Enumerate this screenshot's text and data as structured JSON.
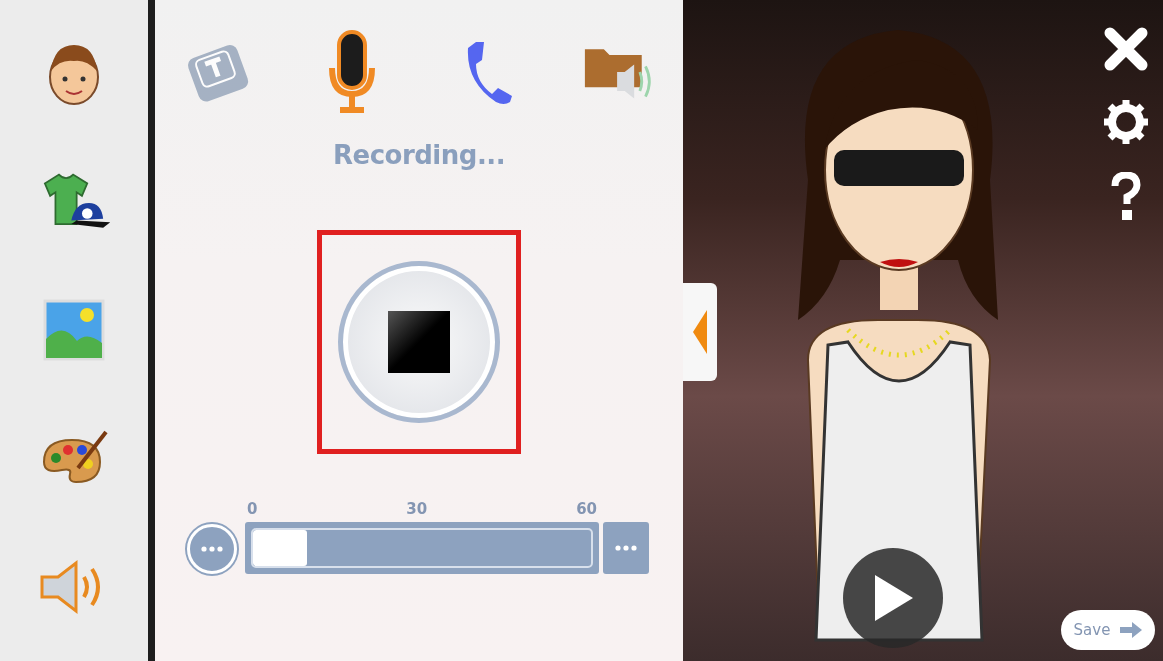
{
  "sidebar": {
    "items": [
      {
        "kind": "face"
      },
      {
        "kind": "outfit"
      },
      {
        "kind": "background"
      },
      {
        "kind": "palette"
      },
      {
        "kind": "audio"
      }
    ]
  },
  "voice_tabs": [
    {
      "kind": "keyboard",
      "selected": false
    },
    {
      "kind": "microphone",
      "selected": true
    },
    {
      "kind": "phone",
      "selected": false
    },
    {
      "kind": "folder",
      "selected": false
    }
  ],
  "status": "Recording...",
  "recording": true,
  "timeline": {
    "ticks": [
      "0",
      "30",
      "60"
    ],
    "level": 0.16
  },
  "save_button": "Save"
}
